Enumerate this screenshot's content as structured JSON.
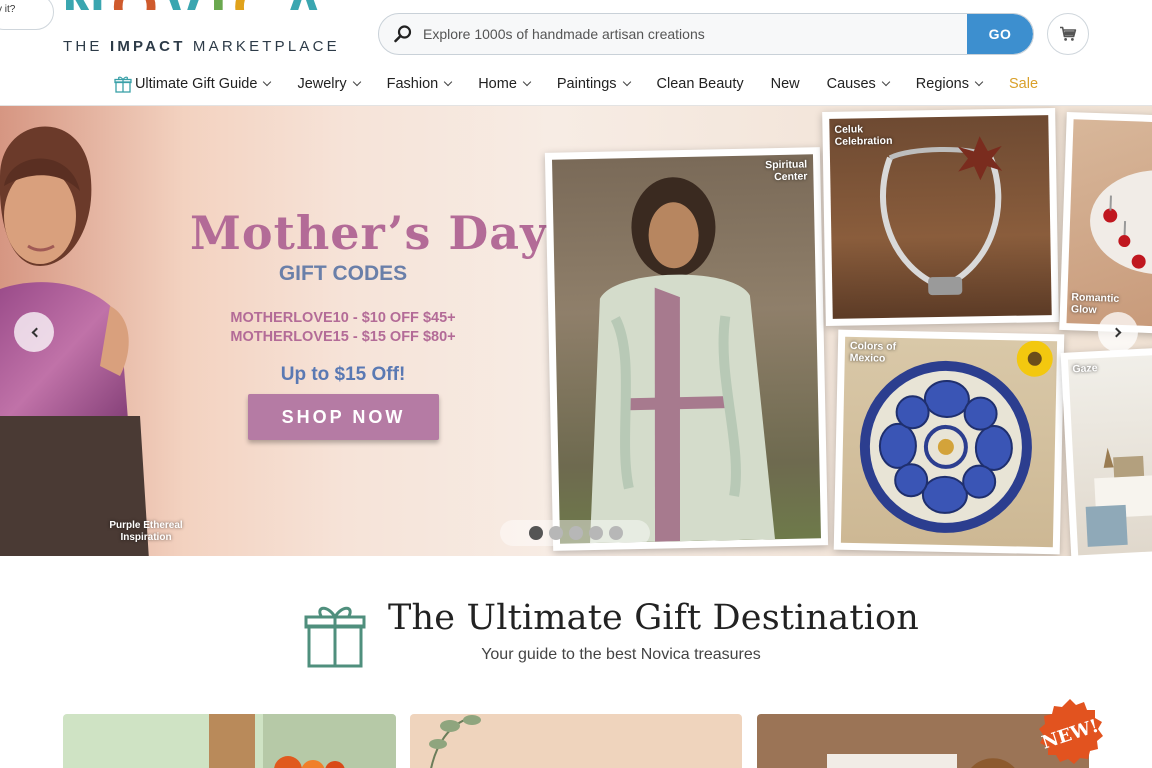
{
  "chat": {
    "label": "y it?"
  },
  "logo": {
    "wordmark": "NOVICA",
    "tagline_pre": "THE ",
    "tagline_bold": "IMPACT",
    "tagline_post": " MARKETPLACE"
  },
  "search": {
    "placeholder": "Explore 1000s of handmade artisan creations",
    "value": "",
    "go_label": "GO"
  },
  "nav": {
    "items": [
      {
        "label": "Ultimate Gift Guide",
        "has_icon": true,
        "dropdown": true
      },
      {
        "label": "Jewelry",
        "dropdown": true
      },
      {
        "label": "Fashion",
        "dropdown": true
      },
      {
        "label": "Home",
        "dropdown": true
      },
      {
        "label": "Paintings",
        "dropdown": true
      },
      {
        "label": "Clean Beauty",
        "dropdown": false
      },
      {
        "label": "New",
        "dropdown": false
      },
      {
        "label": "Causes",
        "dropdown": true
      },
      {
        "label": "Regions",
        "dropdown": true
      },
      {
        "label": "Sale",
        "dropdown": false,
        "highlight": true
      }
    ]
  },
  "hero": {
    "title": "Mother’s Day",
    "subtitle": "GIFT CODES",
    "code1": "MOTHERLOVE10 - $10 OFF $45+",
    "code2": "MOTHERLOVE15 - $15 OFF $80+",
    "upto": "Up to $15 Off!",
    "cta": "SHOP NOW",
    "captions": {
      "left": "Purple Ethereal\nInspiration",
      "robe": "Spiritual\nCenter",
      "necklace": "Celuk\nCelebration",
      "plate": "Colors of\nMexico",
      "earrings": "Romantic\nGlow",
      "gaze": "Gaze"
    },
    "slides_total": 5,
    "active_slide": 1
  },
  "gift_section": {
    "title": "The Ultimate Gift Destination",
    "subtitle": "Your guide to the best Novica treasures",
    "badge": "NEW!"
  },
  "colors": {
    "accent_blue": "#3d8fcf",
    "promo_pink": "#b36b97",
    "promo_blue": "#6a7fa9",
    "sale_gold": "#d9a02a",
    "icon_teal": "#4f8f7d"
  }
}
